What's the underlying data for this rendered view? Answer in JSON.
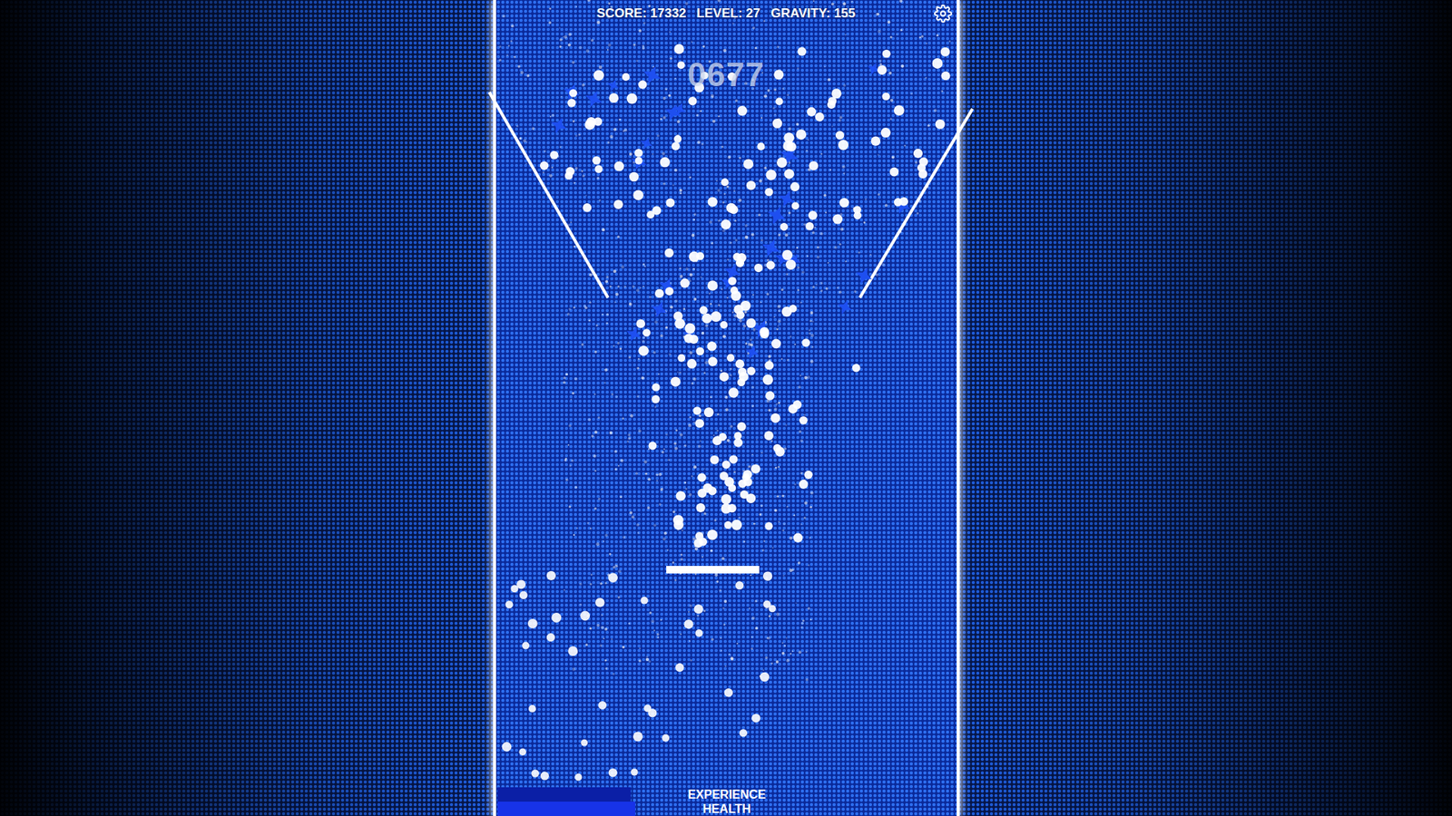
{
  "hud": {
    "stats": [
      "SCORE: 17332",
      "LEVEL: 27",
      "GRAVITY: 155"
    ],
    "countdown": "0677"
  },
  "meters": [
    {
      "label": "EXPERIENCE",
      "level": 0.29,
      "color": "#0b1fa6"
    },
    {
      "label": "HEALTH",
      "level": 0.3,
      "color": "#1733e8"
    }
  ]
}
